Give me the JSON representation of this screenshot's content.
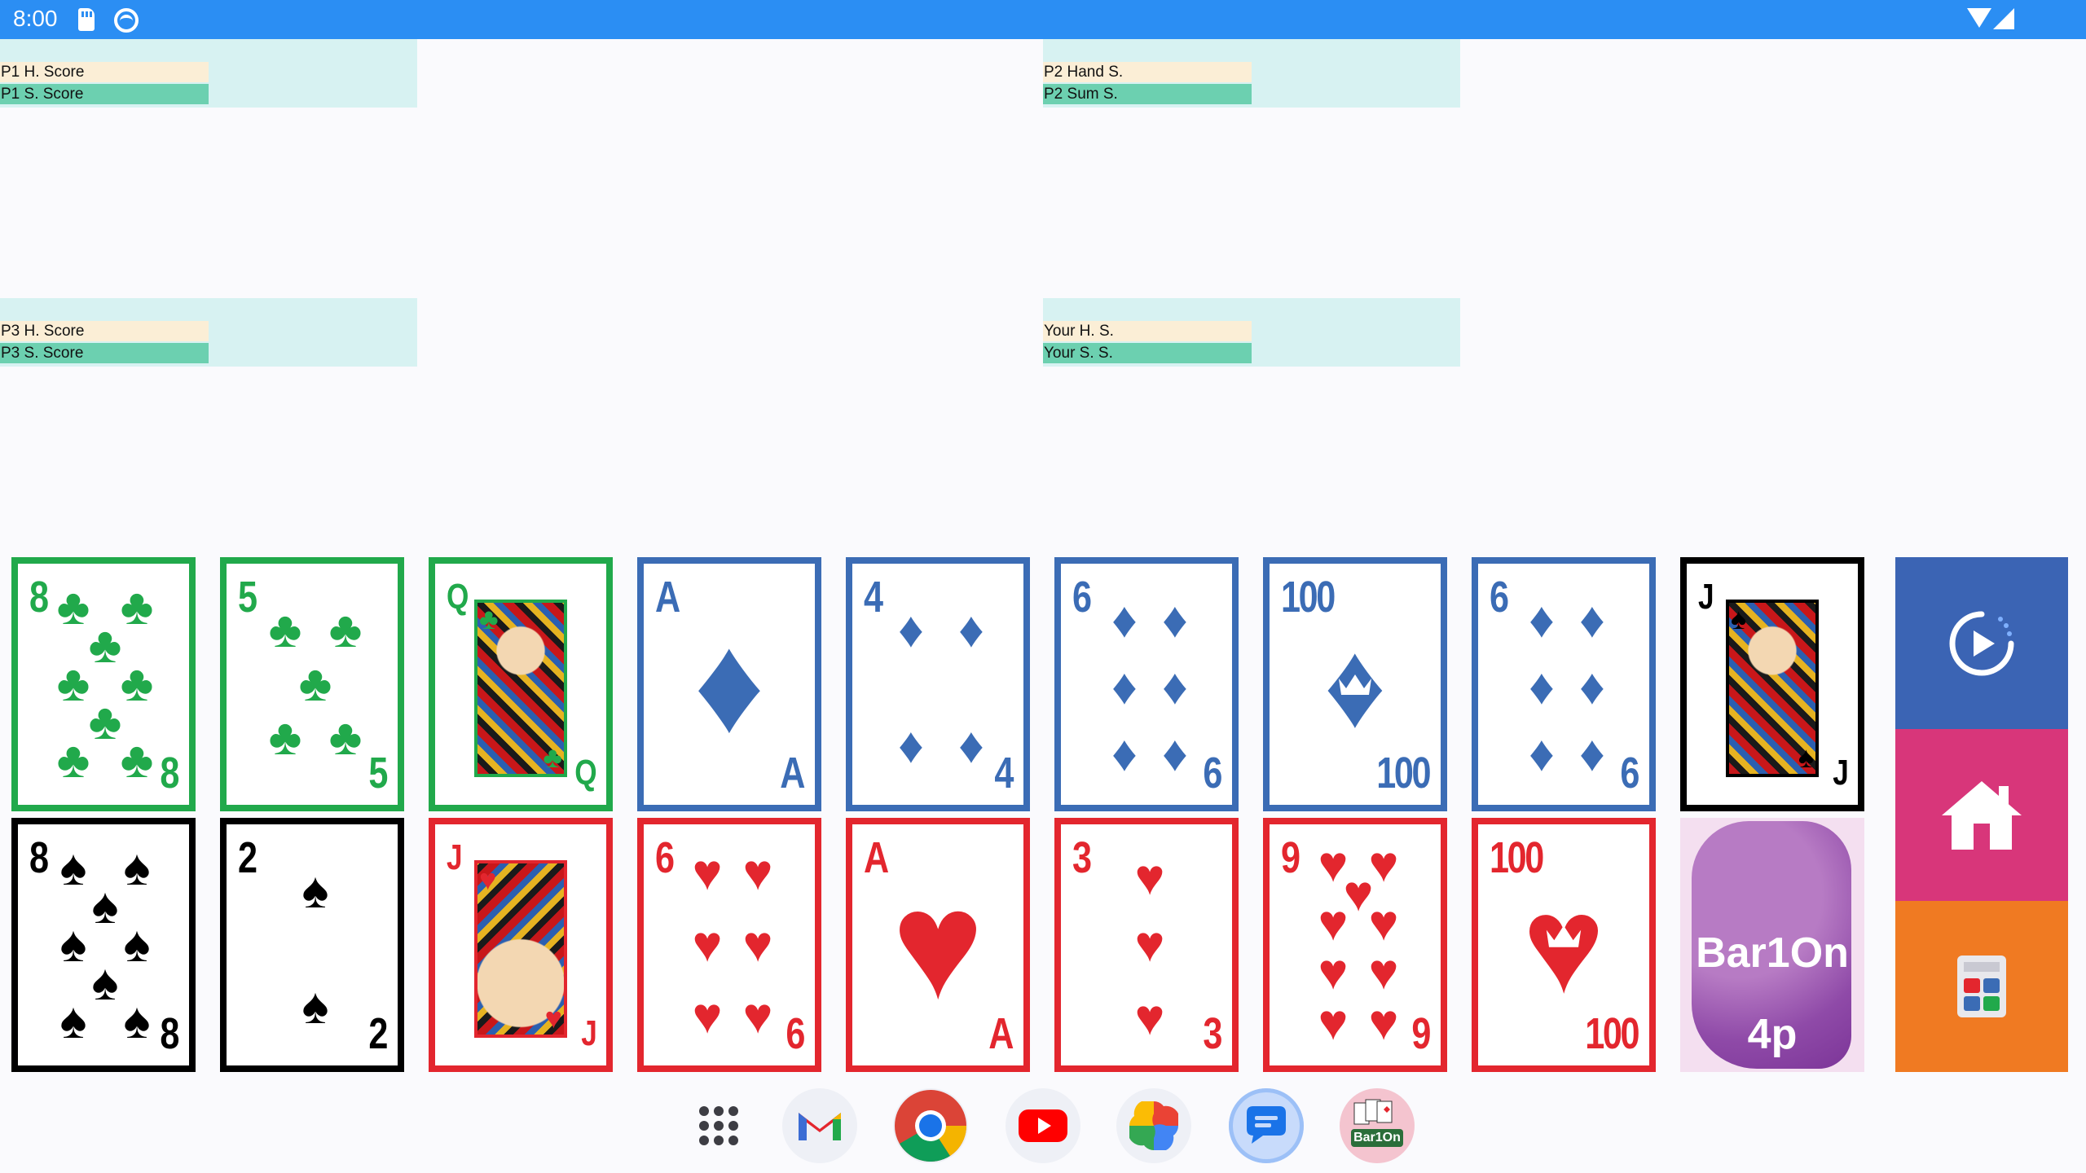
{
  "status_bar": {
    "time": "8:00",
    "icons": [
      "sd-card-icon",
      "sync-icon",
      "wifi-icon",
      "signal-icon"
    ]
  },
  "players": {
    "p1": {
      "hand": "P1 H. Score",
      "sum": "P1 S. Score"
    },
    "p2": {
      "hand": "P2 Hand S.",
      "sum": "P2 Sum S."
    },
    "p3": {
      "hand": "P3 H. Score",
      "sum": "P3 S. Score"
    },
    "you": {
      "hand": "Your H. S.",
      "sum": "Your S. S."
    }
  },
  "cards": {
    "c1": {
      "top": {
        "rank": "8",
        "suit": "♣"
      },
      "bottom": {
        "rank": "8",
        "suit": "♠"
      }
    },
    "c2": {
      "top": {
        "rank": "5",
        "suit": "♣"
      },
      "bottom": {
        "rank": "2",
        "suit": "♠"
      }
    },
    "c3": {
      "top": {
        "rank": "Q",
        "suit": "♣"
      },
      "bottom": {
        "rank": "J",
        "suit": "♥"
      }
    },
    "c4": {
      "top": {
        "rank": "A",
        "suit": "♦"
      },
      "bottom": {
        "rank": "6",
        "suit": "♥"
      }
    },
    "c5": {
      "top": {
        "rank": "4",
        "suit": "♦"
      },
      "bottom": {
        "rank": "A",
        "suit": "♥"
      }
    },
    "c6": {
      "top": {
        "rank": "6",
        "suit": "♦"
      },
      "bottom": {
        "rank": "3",
        "suit": "♥"
      }
    },
    "c7": {
      "top": {
        "rank": "100",
        "suit": "♦"
      },
      "bottom": {
        "rank": "9",
        "suit": "♥"
      }
    },
    "c8": {
      "top": {
        "rank": "6",
        "suit": "♦"
      },
      "bottom": {
        "rank": "100",
        "suit": "♥"
      }
    },
    "c9": {
      "top": {
        "rank": "J",
        "suit": "♠"
      }
    }
  },
  "logo": {
    "line1": "Bar1On",
    "line2": "4p"
  },
  "actions": [
    "replay-button",
    "home-button",
    "calculator-button"
  ],
  "colors": {
    "clubs": "#21a94b",
    "spades": "#000000",
    "diamonds": "#3b6cb5",
    "hearts": "#e3262e",
    "replay_bg": "#3b64b4",
    "home_bg": "#d8367a",
    "calc_bg": "#f07a22",
    "status_bar": "#2b8ef3"
  },
  "taskbar": {
    "apps": [
      "App drawer",
      "Gmail",
      "Chrome",
      "YouTube",
      "Photos",
      "Messages",
      "Bar1On"
    ],
    "bar1on_label": "Bar1On"
  }
}
